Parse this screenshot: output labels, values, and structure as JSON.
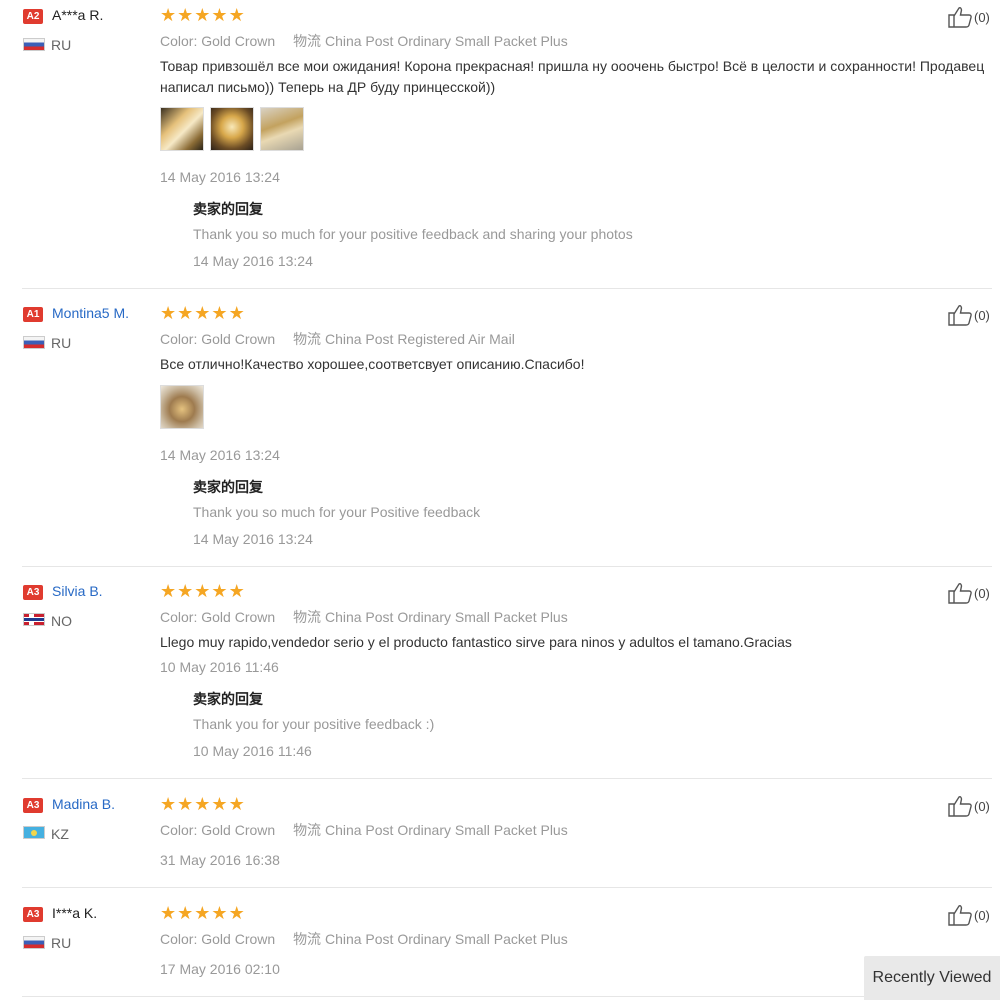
{
  "labels": {
    "color": "Color:",
    "shipping": "物流",
    "reply_title": "卖家的回复"
  },
  "reviews": [
    {
      "badge": "A2",
      "name": "A***a R.",
      "country": "RU",
      "color_value": "Gold Crown",
      "shipping_value": "China Post Ordinary Small Packet Plus",
      "text": "Товар привзошёл все мои ожидания! Корона прекрасная! пришла ну ооочень быстро! Всё в целости и сохранности! Продавец написал письмо)) Теперь на ДР буду принцесской))",
      "date": "14 May 2016 13:24",
      "reply_text": "Thank you so much for your positive feedback and sharing your photos",
      "reply_date": "14 May 2016 13:24",
      "likes": "(0)"
    },
    {
      "badge": "A1",
      "name": "Montina5 M.",
      "country": "RU",
      "color_value": "Gold Crown",
      "shipping_value": "China Post Registered Air Mail",
      "text": "Все отлично!Качество хорошее,соответсвует описанию.Спасибо!",
      "date": "14 May 2016 13:24",
      "reply_text": "Thank you so much for your Positive feedback",
      "reply_date": "14 May 2016 13:24",
      "likes": "(0)"
    },
    {
      "badge": "A3",
      "name": "Silvia B.",
      "country": "NO",
      "color_value": "Gold Crown",
      "shipping_value": "China Post Ordinary Small Packet Plus",
      "text": "Llego muy rapido,vendedor serio y el producto fantastico sirve para ninos y adultos el tamano.Gracias",
      "date": "10 May 2016 11:46",
      "reply_text": "Thank you for your positive feedback :)",
      "reply_date": "10 May 2016 11:46",
      "likes": "(0)"
    },
    {
      "badge": "A3",
      "name": "Madina B.",
      "country": "KZ",
      "color_value": "Gold Crown",
      "shipping_value": "China Post Ordinary Small Packet Plus",
      "date": "31 May 2016 16:38",
      "likes": "(0)"
    },
    {
      "badge": "A3",
      "name": "I***a K.",
      "country": "RU",
      "color_value": "Gold Crown",
      "shipping_value": "China Post Ordinary Small Packet Plus",
      "date": "17 May 2016 02:10",
      "likes": "(0)"
    }
  ],
  "star_color": "#f5a623",
  "badge_color": "#e03b2f",
  "name_link_color": "#2769c5",
  "recently_viewed": "Recently Viewed"
}
